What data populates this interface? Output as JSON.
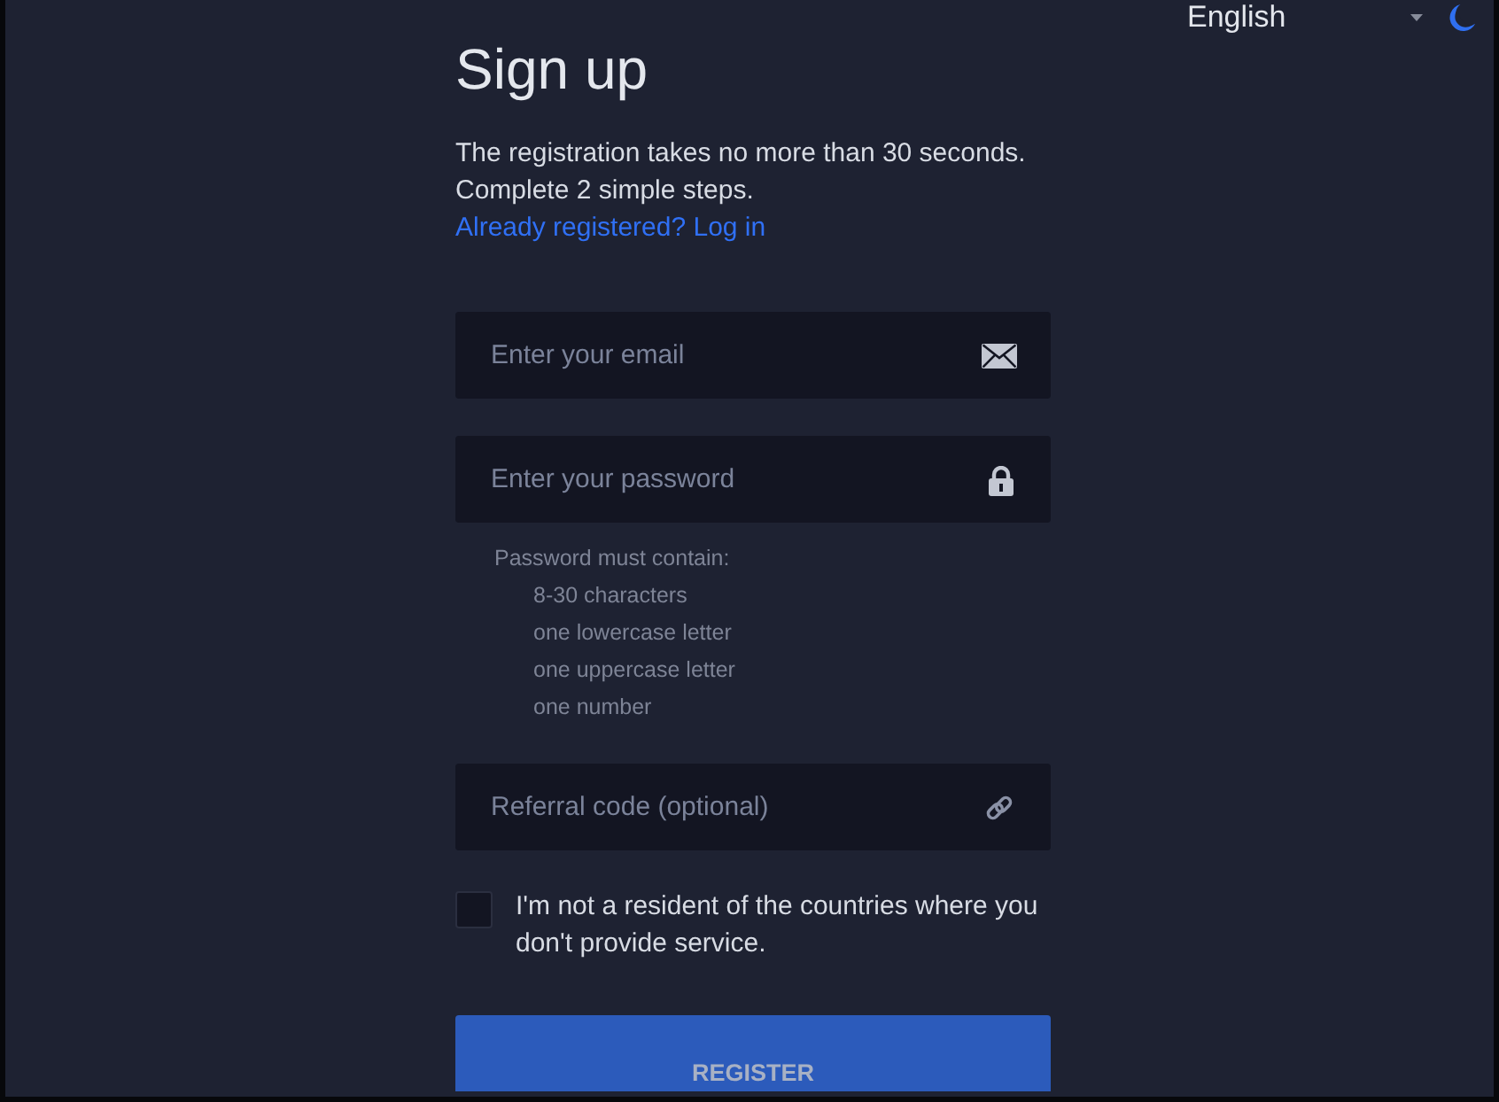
{
  "header": {
    "language_select": {
      "value": "English"
    }
  },
  "form": {
    "title": "Sign up",
    "intro": [
      "The registration takes no more than 30 seconds.",
      "Complete 2 simple steps."
    ],
    "login_link": "Already registered? Log in",
    "email_field": {
      "placeholder": "Enter your email"
    },
    "password_field": {
      "placeholder": "Enter your password"
    },
    "password_rules": {
      "title": "Password must contain:",
      "items": [
        "8-30 characters",
        "one lowercase letter",
        "one uppercase letter",
        "one number"
      ]
    },
    "referral_field": {
      "placeholder": "Referral code (optional)"
    },
    "residency_checkbox": {
      "label": "I'm not a resident of the countries where you don't provide service.",
      "checked": false
    },
    "register_button": {
      "label": "REGISTER",
      "disabled": true
    }
  }
}
